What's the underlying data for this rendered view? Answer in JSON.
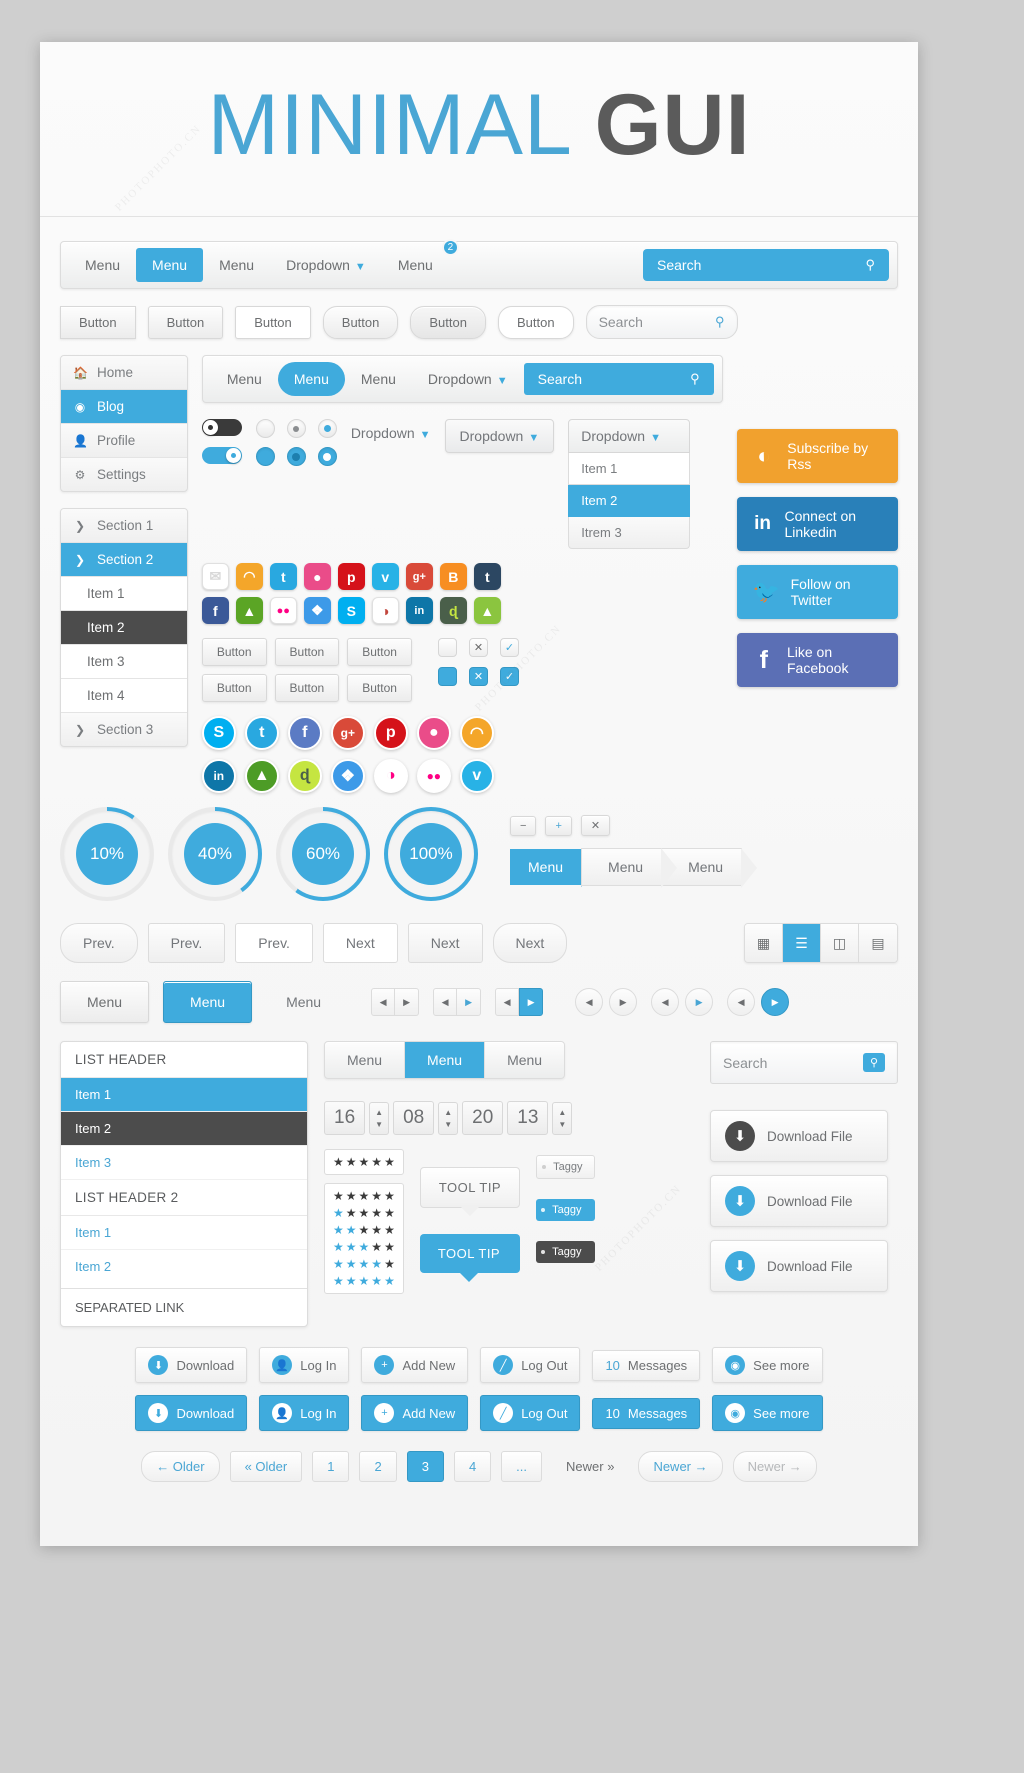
{
  "header": {
    "title_light": "MINIMAL",
    "title_bold": "GUI"
  },
  "navbar1": {
    "items": [
      "Menu",
      "Menu",
      "Menu",
      "Dropdown",
      "Menu"
    ],
    "active_index": 1,
    "dropdown_index": 3,
    "badge_index": 4,
    "badge_count": "2",
    "search_value": "Search",
    "search_icon": "search-icon"
  },
  "buttons_row": {
    "labels": [
      "Button",
      "Button",
      "Button",
      "Button",
      "Button",
      "Button"
    ],
    "search_placeholder": "Search"
  },
  "sidebar": {
    "nav": [
      {
        "label": "Home",
        "icon": "home-icon",
        "state": "normal"
      },
      {
        "label": "Blog",
        "icon": "eye-icon",
        "state": "active"
      },
      {
        "label": "Profile",
        "icon": "user-icon",
        "state": "normal"
      },
      {
        "label": "Settings",
        "icon": "gear-icon",
        "state": "normal"
      }
    ],
    "accordion": [
      {
        "label": "Section 1",
        "icon": "chevron-right-icon",
        "state": "normal"
      },
      {
        "label": "Section 2",
        "icon": "chevron-down-icon",
        "state": "active"
      },
      {
        "label": "Item 1",
        "icon": "",
        "state": "plain"
      },
      {
        "label": "Item 2",
        "icon": "",
        "state": "dark"
      },
      {
        "label": "Item 3",
        "icon": "",
        "state": "plain"
      },
      {
        "label": "Item 4",
        "icon": "",
        "state": "plain"
      },
      {
        "label": "Section 3",
        "icon": "chevron-right-icon",
        "state": "normal"
      }
    ]
  },
  "navbar2": {
    "items": [
      "Menu",
      "Menu",
      "Menu",
      "Dropdown"
    ],
    "active_index": 1,
    "search_value": "Search"
  },
  "controls": {
    "dropdown_plain": "Dropdown",
    "dropdown_box": "Dropdown",
    "dropdown_open_label": "Dropdown",
    "dropdown_open_items": [
      "Item 1",
      "Item 2",
      "Itrem 3"
    ],
    "dropdown_open_active": 1
  },
  "social_squares_row1": [
    {
      "name": "mail-icon",
      "glyph": "✉",
      "color": "#ffffff",
      "fg": "#d8d8d8"
    },
    {
      "name": "rss-icon",
      "glyph": "◠",
      "color": "#f4a62a",
      "fg": "#ffffff"
    },
    {
      "name": "twitter-icon",
      "glyph": "t",
      "color": "#29a8e0",
      "fg": "#ffffff"
    },
    {
      "name": "dribbble-icon",
      "glyph": "●",
      "color": "#ea4c89",
      "fg": "#ffffff"
    },
    {
      "name": "pinterest-icon",
      "glyph": "p",
      "color": "#d5121a",
      "fg": "#ffffff"
    },
    {
      "name": "vimeo-icon",
      "glyph": "v",
      "color": "#28b2e6",
      "fg": "#ffffff"
    },
    {
      "name": "googleplus-icon",
      "glyph": "g+",
      "color": "#d94a39",
      "fg": "#ffffff"
    },
    {
      "name": "blogger-icon",
      "glyph": "B",
      "color": "#f78e22",
      "fg": "#ffffff"
    },
    {
      "name": "tumblr-icon",
      "glyph": "t",
      "color": "#2c4762",
      "fg": "#ffffff"
    }
  ],
  "social_squares_row2": [
    {
      "name": "facebook-icon",
      "glyph": "f",
      "color": "#3b5998",
      "fg": "#ffffff"
    },
    {
      "name": "evernote-icon",
      "glyph": "▲",
      "color": "#5ba525",
      "fg": "#ffffff"
    },
    {
      "name": "flickr-icon",
      "glyph": "●●",
      "color": "#ffffff",
      "fg": "#ff0084"
    },
    {
      "name": "dropbox-icon",
      "glyph": "❖",
      "color": "#3d9ae8",
      "fg": "#ffffff"
    },
    {
      "name": "skype-icon",
      "glyph": "S",
      "color": "#00aff0",
      "fg": "#ffffff"
    },
    {
      "name": "picasa-icon",
      "glyph": "◑",
      "color": "#ffffff",
      "fg": "#c2453c"
    },
    {
      "name": "linkedin-icon",
      "glyph": "in",
      "color": "#0e76a8",
      "fg": "#ffffff"
    },
    {
      "name": "deviantart-icon",
      "glyph": "ɖ",
      "color": "#4a5f4a",
      "fg": "#c5e541"
    },
    {
      "name": "android-icon",
      "glyph": "▲",
      "color": "#8bc53f",
      "fg": "#ffffff"
    }
  ],
  "social_circles_row1": [
    {
      "name": "skype-icon",
      "glyph": "S",
      "color": "#00aff0"
    },
    {
      "name": "twitter-icon",
      "glyph": "t",
      "color": "#29a8e0"
    },
    {
      "name": "facebook-icon",
      "glyph": "f",
      "color": "#5b7bc4"
    },
    {
      "name": "googleplus-icon",
      "glyph": "g+",
      "color": "#d94a39"
    },
    {
      "name": "pinterest-icon",
      "glyph": "p",
      "color": "#d5121a"
    },
    {
      "name": "dribbble-icon",
      "glyph": "●",
      "color": "#ea4c89"
    },
    {
      "name": "rss-icon",
      "glyph": "◠",
      "color": "#f4a62a"
    }
  ],
  "social_circles_row2": [
    {
      "name": "linkedin-icon",
      "glyph": "in",
      "color": "#0e76a8"
    },
    {
      "name": "evernote-icon",
      "glyph": "▲",
      "color": "#4d9c26"
    },
    {
      "name": "deviantart-icon",
      "glyph": "ɖ",
      "color": "#c5e541"
    },
    {
      "name": "dropbox-icon",
      "glyph": "❖",
      "color": "#3d9ae8"
    },
    {
      "name": "picasa-icon",
      "glyph": "◑",
      "color": "#ffffff"
    },
    {
      "name": "flickr-icon",
      "glyph": "●●",
      "color": "#ffffff"
    },
    {
      "name": "vimeo-icon",
      "glyph": "v",
      "color": "#28b2e6"
    }
  ],
  "small_buttons": {
    "row1": [
      "Button",
      "Button",
      "Button"
    ],
    "row2": [
      "Button",
      "Button",
      "Button"
    ]
  },
  "checkboxes": {
    "row1": [
      "empty",
      "cross",
      "check"
    ],
    "row2": [
      "filled",
      "cross",
      "check"
    ]
  },
  "cta": [
    {
      "label": "Subscribe by Rss",
      "icon": "rss-icon",
      "color": "#f1a12e"
    },
    {
      "label": "Connect on Linkedin",
      "icon": "linkedin-icon",
      "color": "#2980b9"
    },
    {
      "label": "Follow on Twitter",
      "icon": "twitter-icon",
      "color": "#3fabdd"
    },
    {
      "label": "Like on Facebook",
      "icon": "facebook-icon",
      "color": "#5b6fb5"
    }
  ],
  "progress": [
    {
      "label": "10%",
      "value": 10
    },
    {
      "label": "40%",
      "value": 40
    },
    {
      "label": "60%",
      "value": 60
    },
    {
      "label": "100%",
      "value": 100
    }
  ],
  "mini_buttons": [
    "−",
    "+",
    "✕"
  ],
  "arrow_menu": [
    "Menu",
    "Menu",
    "Menu"
  ],
  "prev_next": {
    "prev": [
      "Prev.",
      "Prev.",
      "Prev."
    ],
    "next": [
      "Next",
      "Next",
      "Next"
    ]
  },
  "view_toggle": {
    "items": [
      "grid-view-icon",
      "list-view-icon",
      "column-view-icon",
      "detail-view-icon"
    ],
    "active_index": 1
  },
  "menu_row3": {
    "items": [
      "Menu",
      "Menu",
      "Menu"
    ],
    "active_index": 1
  },
  "pagers": {
    "square_groups": 3,
    "active_group": 2,
    "circle_groups": 3
  },
  "list_panel": [
    {
      "label": "LIST HEADER",
      "type": "header"
    },
    {
      "label": "Item 1",
      "type": "active"
    },
    {
      "label": "Item 2",
      "type": "dark"
    },
    {
      "label": "Item 3",
      "type": "item"
    },
    {
      "label": "LIST HEADER 2",
      "type": "header"
    },
    {
      "label": "Item 1",
      "type": "item"
    },
    {
      "label": "Item 2",
      "type": "item"
    },
    {
      "label": "SEPARATED LINK",
      "type": "separated"
    }
  ],
  "tabs": {
    "items": [
      "Menu",
      "Menu",
      "Menu"
    ],
    "active_index": 1,
    "search_placeholder": "Search"
  },
  "time_spinner": {
    "values": [
      "16",
      "08",
      "20",
      "13"
    ]
  },
  "ratings": {
    "top": {
      "filled": 0,
      "total": 5
    },
    "stack": [
      {
        "filled": 0,
        "total": 5
      },
      {
        "filled": 1,
        "total": 5
      },
      {
        "filled": 2,
        "total": 5
      },
      {
        "filled": 3,
        "total": 5
      },
      {
        "filled": 4,
        "total": 5
      },
      {
        "filled": 5,
        "total": 5
      }
    ]
  },
  "tooltips": {
    "light": "TOOL TIP",
    "blue": "TOOL TIP"
  },
  "taggy": [
    "Taggy",
    "Taggy",
    "Taggy"
  ],
  "download_files": [
    {
      "label": "Download File",
      "icon": "download-icon",
      "color": "#4c4c4c"
    },
    {
      "label": "Download File",
      "icon": "download-icon",
      "color": "#3fabdd"
    },
    {
      "label": "Download File",
      "icon": "download-icon",
      "color": "#3fabdd"
    }
  ],
  "action_bar_light": [
    {
      "label": "Download",
      "icon": "download-icon",
      "count": ""
    },
    {
      "label": "Log In",
      "icon": "user-icon",
      "count": ""
    },
    {
      "label": "Add New",
      "icon": "plus-icon",
      "count": ""
    },
    {
      "label": "Log Out",
      "icon": "logout-icon",
      "count": ""
    },
    {
      "label": "Messages",
      "icon": "",
      "count": "10"
    },
    {
      "label": "See more",
      "icon": "eye-icon",
      "count": ""
    }
  ],
  "action_bar_blue": [
    {
      "label": "Download",
      "icon": "download-icon",
      "count": ""
    },
    {
      "label": "Log In",
      "icon": "user-icon",
      "count": ""
    },
    {
      "label": "Add New",
      "icon": "plus-icon",
      "count": ""
    },
    {
      "label": "Log Out",
      "icon": "logout-icon",
      "count": ""
    },
    {
      "label": "Messages",
      "icon": "",
      "count": "10"
    },
    {
      "label": "See more",
      "icon": "eye-icon",
      "count": ""
    }
  ],
  "pagination": {
    "older_arrow": "← Older",
    "older_chevron": "« Older",
    "pages": [
      "1",
      "2",
      "3",
      "4",
      "..."
    ],
    "active_page": "3",
    "newer_chevron": "Newer »",
    "newer_arrow": "Newer →",
    "newer_muted": "Newer →"
  },
  "colors": {
    "accent": "#3fabdd",
    "accent_text": "#4aa6d4",
    "dark": "#4c4c4c",
    "text": "#6d6f71",
    "panel": "#f6f6f6"
  }
}
